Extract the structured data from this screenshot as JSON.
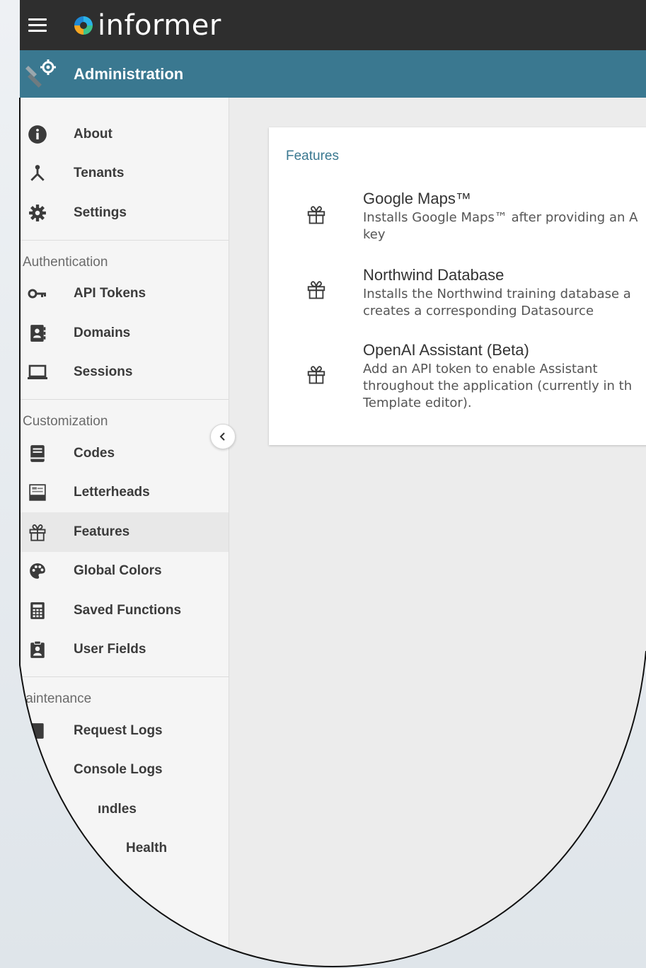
{
  "app": {
    "brand": "informer"
  },
  "header": {
    "section_title": "Administration"
  },
  "sidebar": {
    "groups": [
      {
        "title": "",
        "items": [
          {
            "label": "About",
            "icon": "info-icon"
          },
          {
            "label": "Tenants",
            "icon": "tenants-icon"
          },
          {
            "label": "Settings",
            "icon": "gear-icon"
          }
        ]
      },
      {
        "title": "Authentication",
        "items": [
          {
            "label": "API Tokens",
            "icon": "key-icon"
          },
          {
            "label": "Domains",
            "icon": "contact-book-icon"
          },
          {
            "label": "Sessions",
            "icon": "laptop-icon"
          }
        ]
      },
      {
        "title": "Customization",
        "items": [
          {
            "label": "Codes",
            "icon": "book-icon"
          },
          {
            "label": "Letterheads",
            "icon": "letterhead-icon"
          },
          {
            "label": "Features",
            "icon": "gift-icon",
            "active": true
          },
          {
            "label": "Global Colors",
            "icon": "palette-icon"
          },
          {
            "label": "Saved Functions",
            "icon": "calculator-icon"
          },
          {
            "label": "User Fields",
            "icon": "clipboard-user-icon"
          }
        ]
      },
      {
        "title": "laintenance",
        "items": [
          {
            "label": "Request Logs",
            "icon": "log-icon"
          },
          {
            "label": "Console Logs",
            "icon": "console-icon"
          },
          {
            "label": "ındles",
            "icon": "bundle-icon"
          },
          {
            "label": "Health",
            "icon": "health-icon"
          }
        ]
      }
    ]
  },
  "main": {
    "card_title": "Features",
    "features": [
      {
        "name": "Google Maps™",
        "description": "Installs Google Maps™ after providing an A key",
        "icon": "gift-icon"
      },
      {
        "name": "Northwind Database",
        "description": "Installs the Northwind training database a creates a corresponding Datasource",
        "icon": "gift-icon"
      },
      {
        "name": "OpenAI Assistant (Beta)",
        "description": "Add an API token to enable Assistant throughout the application (currently in th Template editor).",
        "icon": "gift-icon"
      }
    ]
  },
  "colors": {
    "topbar": "#2e2e2e",
    "accent": "#3a7890",
    "sidebar_bg": "#f5f5f5",
    "main_bg": "#ececec"
  }
}
